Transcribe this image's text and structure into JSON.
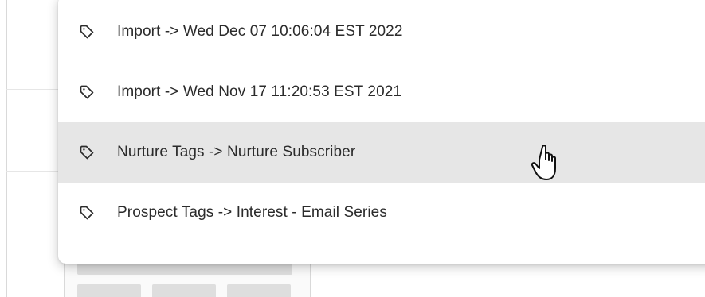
{
  "tag_menu": {
    "options": [
      {
        "label": "Import -> Wed Dec 07 10:06:04 EST 2022",
        "icon": "tag-icon",
        "hovered": false
      },
      {
        "label": "Import -> Wed Nov 17 11:20:53 EST 2021",
        "icon": "tag-icon",
        "hovered": false
      },
      {
        "label": "Nurture Tags -> Nurture Subscriber",
        "icon": "tag-icon",
        "hovered": true
      },
      {
        "label": "Prospect Tags -> Interest - Email Series",
        "icon": "tag-icon",
        "hovered": false
      }
    ],
    "hover_color": "#e6e6e6"
  },
  "cursor": {
    "icon": "pointer-hand-icon"
  }
}
